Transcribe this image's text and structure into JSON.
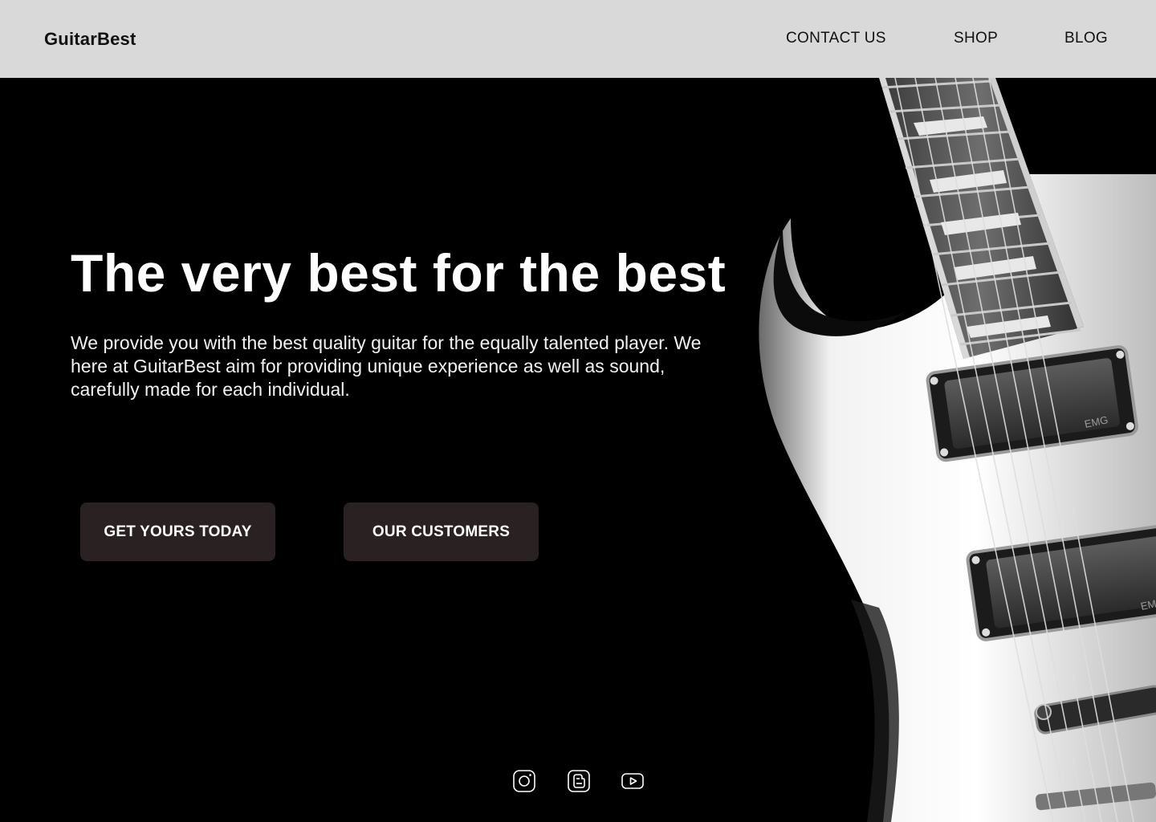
{
  "brand": {
    "name": "GuitarBest"
  },
  "nav": {
    "contact": "CONTACT US",
    "shop": "SHOP",
    "blog": "BLOG"
  },
  "hero": {
    "title": "The very best for the best",
    "description": "We provide you with the best quality guitar for the equally talented player. We here at GuitarBest aim for providing unique experience as well as sound, carefully made for each individual.",
    "primary_cta": "GET YOURS TODAY",
    "secondary_cta": "OUR CUSTOMERS",
    "image": {
      "subject": "black and white electric guitar",
      "pickup_brand": "EMG"
    }
  },
  "social": [
    {
      "icon": "instagram-icon"
    },
    {
      "icon": "blogger-icon"
    },
    {
      "icon": "youtube-icon"
    }
  ],
  "colors": {
    "navbar_bg": "#d9d9d9",
    "hero_bg": "#000000",
    "button_bg": "#2a2122",
    "text_light": "#ffffff",
    "text_dark": "#111111"
  }
}
